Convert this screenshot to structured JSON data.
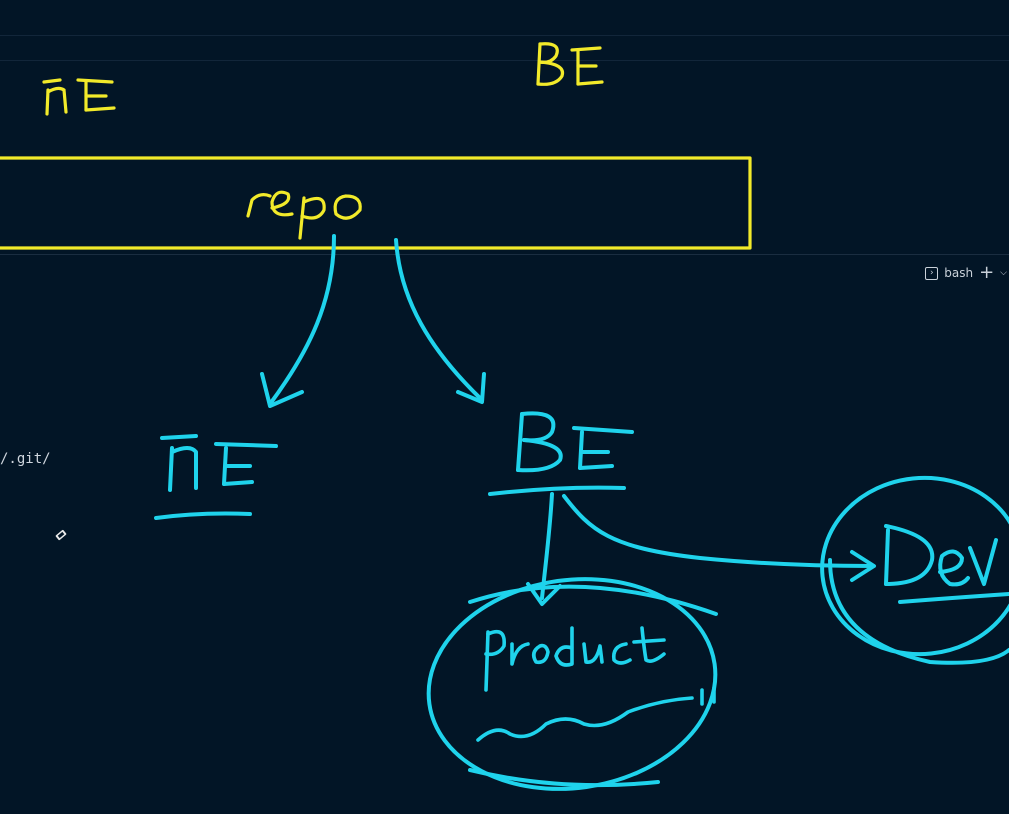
{
  "terminal": {
    "shell_label": "bash",
    "shell_icon": "terminal-icon",
    "add_icon": "plus-icon",
    "dropdown_icon": "chevron-down-icon",
    "output_line": "/.git/"
  },
  "annotations": {
    "fe_top": "FE",
    "be_top": "BE",
    "repo": "repo",
    "fe_lower": "FE",
    "be_lower": "BE",
    "product": "product",
    "dev": "Dev"
  },
  "colors": {
    "background": "#021526",
    "yellow_ink": "#f2ea2a",
    "cyan_ink": "#1fd3ec",
    "text": "#c9d1d9"
  }
}
